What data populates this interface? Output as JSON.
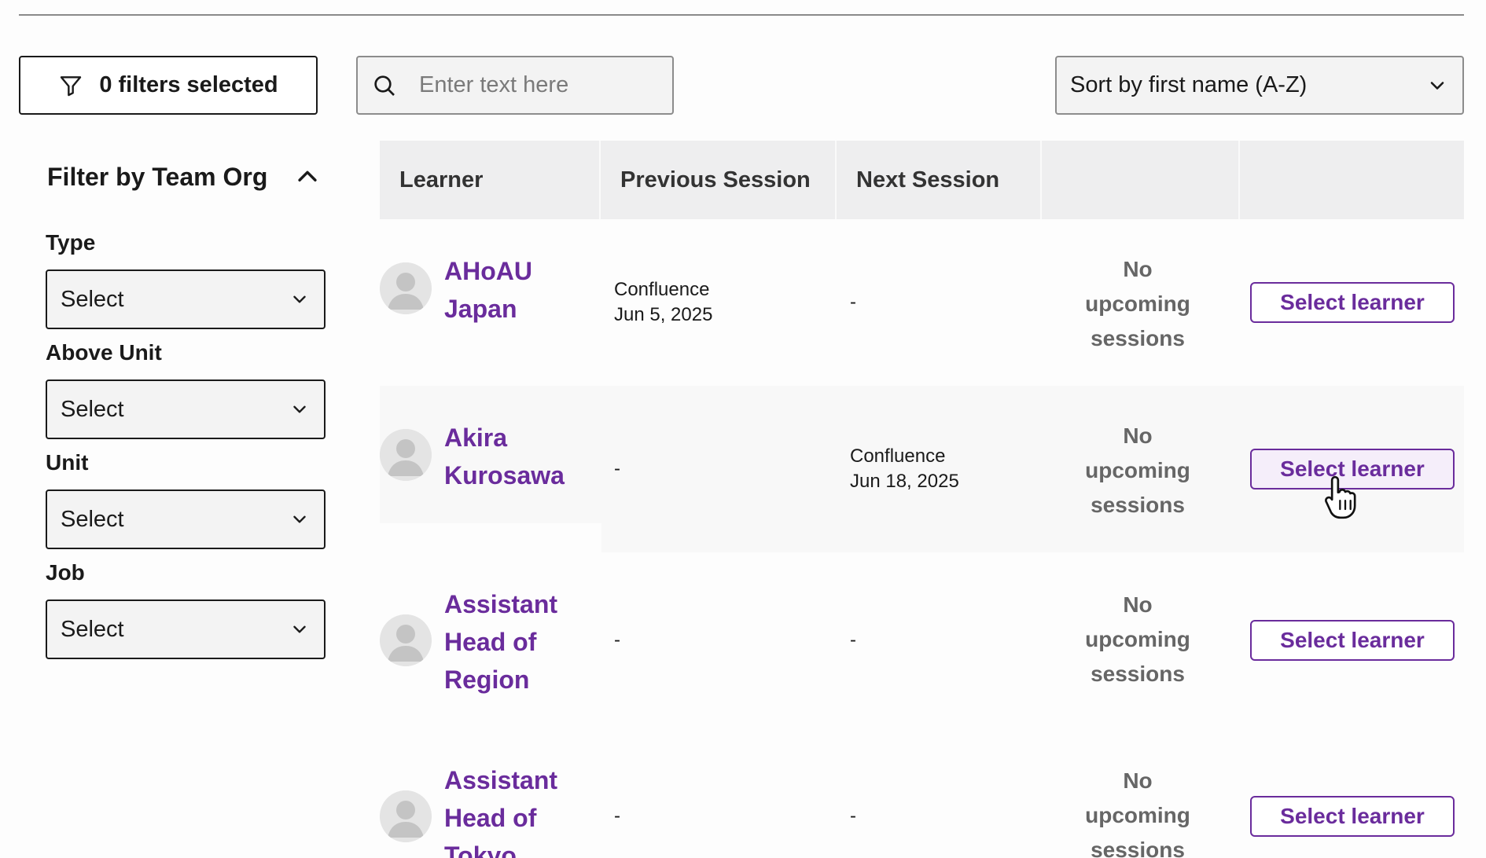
{
  "toolbar": {
    "filters_label": "0 filters selected",
    "search_placeholder": "Enter text here",
    "sort_label": "Sort by first name (A-Z)"
  },
  "sidebar": {
    "title": "Filter by Team Org",
    "fields": [
      {
        "label": "Type",
        "value": "Select"
      },
      {
        "label": "Above Unit",
        "value": "Select"
      },
      {
        "label": "Unit",
        "value": "Select"
      },
      {
        "label": "Job",
        "value": "Select"
      }
    ]
  },
  "table": {
    "headers": [
      "Learner",
      "Previous Session",
      "Next Session",
      "",
      ""
    ],
    "rows": [
      {
        "name_lines": [
          "AHoAU",
          "Japan"
        ],
        "previous": {
          "title": "Confluence",
          "date": "Jun 5, 2025"
        },
        "next": "-",
        "upcoming_lines": [
          "No",
          "upcoming",
          "sessions"
        ],
        "action": "Select learner"
      },
      {
        "name_lines": [
          "Akira",
          "Kurosawa"
        ],
        "previous": "-",
        "next": {
          "title": "Confluence",
          "date": "Jun 18, 2025"
        },
        "upcoming_lines": [
          "No",
          "upcoming",
          "sessions"
        ],
        "action": "Select learner"
      },
      {
        "name_lines": [
          "Assistant",
          "Head of",
          "Region"
        ],
        "previous": "-",
        "next": "-",
        "upcoming_lines": [
          "No",
          "upcoming",
          "sessions"
        ],
        "action": "Select learner"
      },
      {
        "name_lines": [
          "Assistant",
          "Head of",
          "Tokyo"
        ],
        "previous": "-",
        "next": "-",
        "upcoming_lines": [
          "No",
          "upcoming",
          "sessions"
        ],
        "action": "Select learner"
      }
    ]
  },
  "colors": {
    "accent": "#6a2c9c",
    "header_bg": "#eeeeef"
  },
  "icons": [
    "filter-icon",
    "search-icon",
    "chevron-down-icon",
    "chevron-up-icon",
    "avatar-placeholder-icon",
    "hand-pointer-cursor"
  ]
}
